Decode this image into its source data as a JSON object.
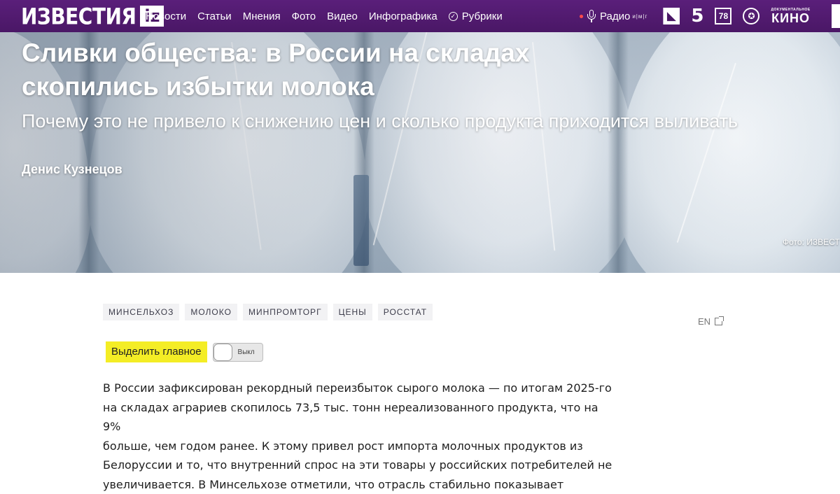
{
  "logo": {
    "word": "ИЗВЕСТИЯ",
    "badge": "iz"
  },
  "nav": {
    "items": [
      "Новости",
      "Статьи",
      "Мнения",
      "Фото",
      "Видео",
      "Инфографика"
    ],
    "rubrics": "Рубрики"
  },
  "radio": {
    "label": "Радио",
    "letters": "и|м|г"
  },
  "channels": {
    "ch5": "5",
    "ch78": "78",
    "kino_small": "ДОКУМЕНТАЛЬНОЕ",
    "kino_big": "КИНО"
  },
  "hero": {
    "title": "Сливки общества: в России на складах скопились избытки молока",
    "subtitle": "Почему это не привело к снижению цен и сколько продукта приходится выливать",
    "author": "Денис Кузнецов",
    "photo_credit": "Фото: ИЗВЕСТ"
  },
  "tags": [
    "МИНСЕЛЬХОЗ",
    "МОЛОКО",
    "МИНПРОМТОРГ",
    "ЦЕНЫ",
    "РОССТАТ"
  ],
  "lang_switch": "EN",
  "highlight": {
    "button": "Выделить главное",
    "toggle_state": "Выкл"
  },
  "article": {
    "lines": [
      "В России зафиксирован рекордный переизбыток сырого молока — по итогам 2025-го",
      "на складах аграриев скопилось 73,5 тыс. тонн нереализованного продукта, что на 9%",
      "больше, чем годом ранее. К этому привел рост импорта молочных продуктов из",
      "Белоруссии и то, что внутренний спрос на эти товары у российских потребителей не",
      "увеличивается. В Минсельхозе отметили, что отрасль стабильно показывает"
    ]
  },
  "colors": {
    "topbar": "#4a1766",
    "highlight": "#f4ed25"
  }
}
